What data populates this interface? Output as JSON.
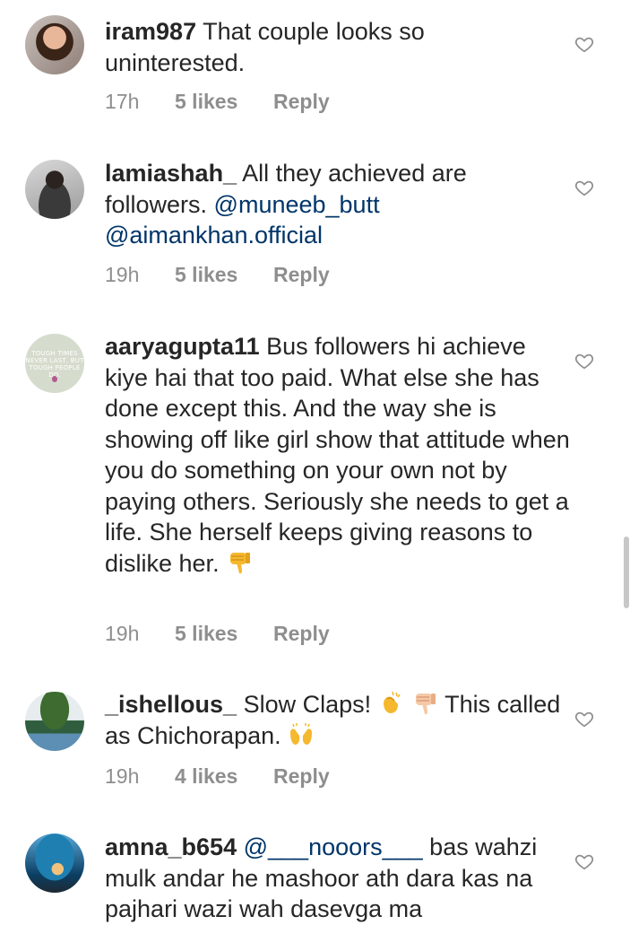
{
  "comments": [
    {
      "username": "iram987",
      "text": " That couple looks so uninterested.",
      "time": "17h",
      "likes": "5 likes",
      "reply": "Reply"
    },
    {
      "username": "lamiashah_",
      "text": " All they achieved are followers. ",
      "mention1": "@muneeb_butt",
      "mention2": "@aimankhan.official",
      "time": "19h",
      "likes": "5 likes",
      "reply": "Reply"
    },
    {
      "username": "aaryagupta11",
      "text": " Bus followers hi achieve kiye hai that too paid. What else she has done except this. And the way she is showing off like girl show that attitude when you do something on your own not by paying others. Seriously she needs to get a life. She herself keeps giving reasons to dislike her. ",
      "avatar_text": "TOUGH TIMES NEVER LAST, BUT TOUGH PEOPLE DO.",
      "time": "19h",
      "likes": "5 likes",
      "reply": "Reply"
    },
    {
      "username": "_ishellous_",
      "text_a": " Slow Claps! ",
      "text_b": " This called as Chichorapan. ",
      "time": "19h",
      "likes": "4 likes",
      "reply": "Reply"
    },
    {
      "username": "amna_b654",
      "mention": "@___nooors___",
      "text": " bas wahzi mulk andar he mashoor ath dara kas na pajhari wazi wah dasevga ma"
    }
  ],
  "icons": {
    "like": "heart-outline-icon",
    "thumbs_down": "thumbs-down-emoji",
    "clap": "clapping-hands-emoji",
    "raised_hands": "raised-hands-emoji"
  },
  "colors": {
    "text": "#262626",
    "meta": "#8e8e8e",
    "mention": "#003569"
  }
}
